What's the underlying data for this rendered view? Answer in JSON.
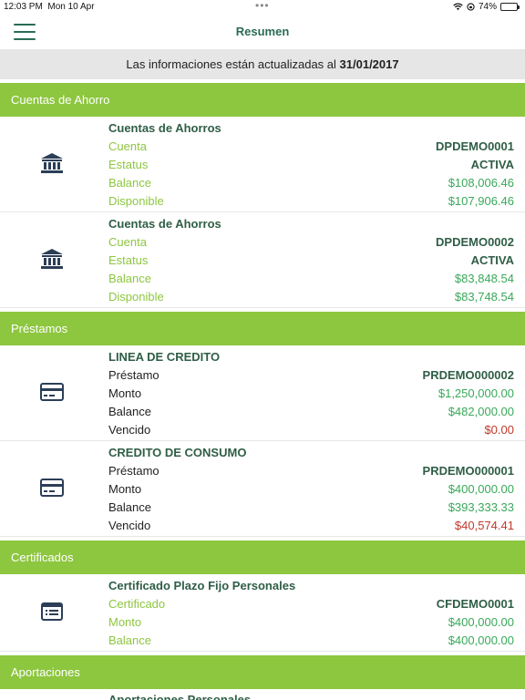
{
  "status_bar": {
    "time": "12:03 PM",
    "date": "Mon 10 Apr",
    "battery": "74%",
    "battery_level": 0.74
  },
  "nav": {
    "title": "Resumen"
  },
  "banner": {
    "text": "Las informaciones están actualizadas al ",
    "date": "31/01/2017"
  },
  "sections": {
    "ahorro": {
      "title": "Cuentas de Ahorro",
      "accounts": [
        {
          "name": "Cuentas de Ahorros",
          "rows": [
            {
              "label": "Cuenta",
              "value": "DPDEMO0001"
            },
            {
              "label": "Estatus",
              "value": "ACTIVA"
            },
            {
              "label": "Balance",
              "value": "$108,006.46"
            },
            {
              "label": "Disponible",
              "value": "$107,906.46"
            }
          ]
        },
        {
          "name": "Cuentas de Ahorros",
          "rows": [
            {
              "label": "Cuenta",
              "value": "DPDEMO0002"
            },
            {
              "label": "Estatus",
              "value": "ACTIVA"
            },
            {
              "label": "Balance",
              "value": "$83,848.54"
            },
            {
              "label": "Disponible",
              "value": "$83,748.54"
            }
          ]
        }
      ]
    },
    "prestamos": {
      "title": "Préstamos",
      "accounts": [
        {
          "name": "LINEA DE CREDITO",
          "rows": [
            {
              "label": "Préstamo",
              "value": "PRDEMO000002"
            },
            {
              "label": "Monto",
              "value": "$1,250,000.00"
            },
            {
              "label": "Balance",
              "value": "$482,000.00"
            },
            {
              "label": "Vencido",
              "value": "$0.00"
            }
          ]
        },
        {
          "name": "CREDITO DE CONSUMO",
          "rows": [
            {
              "label": "Préstamo",
              "value": "PRDEMO000001"
            },
            {
              "label": "Monto",
              "value": "$400,000.00"
            },
            {
              "label": "Balance",
              "value": "$393,333.33"
            },
            {
              "label": "Vencido",
              "value": "$40,574.41"
            }
          ]
        }
      ]
    },
    "certificados": {
      "title": "Certificados",
      "accounts": [
        {
          "name": "Certificado Plazo Fijo Personales",
          "rows": [
            {
              "label": "Certificado",
              "value": "CFDEMO0001"
            },
            {
              "label": "Monto",
              "value": "$400,000.00"
            },
            {
              "label": "Balance",
              "value": "$400,000.00"
            }
          ]
        }
      ]
    },
    "aportaciones": {
      "title": "Aportaciones",
      "accounts": [
        {
          "name": "Aportaciones Personales"
        }
      ]
    }
  },
  "icons": {
    "bank": "bank-icon",
    "loan": "credit-card-icon",
    "certificate": "list-card-icon"
  },
  "colors": {
    "accent_green": "#8dc63f",
    "dark_green": "#2a6b55",
    "money_green": "#3aa85a",
    "overdue_red": "#c0392b",
    "icon_navy": "#2c3e57"
  }
}
